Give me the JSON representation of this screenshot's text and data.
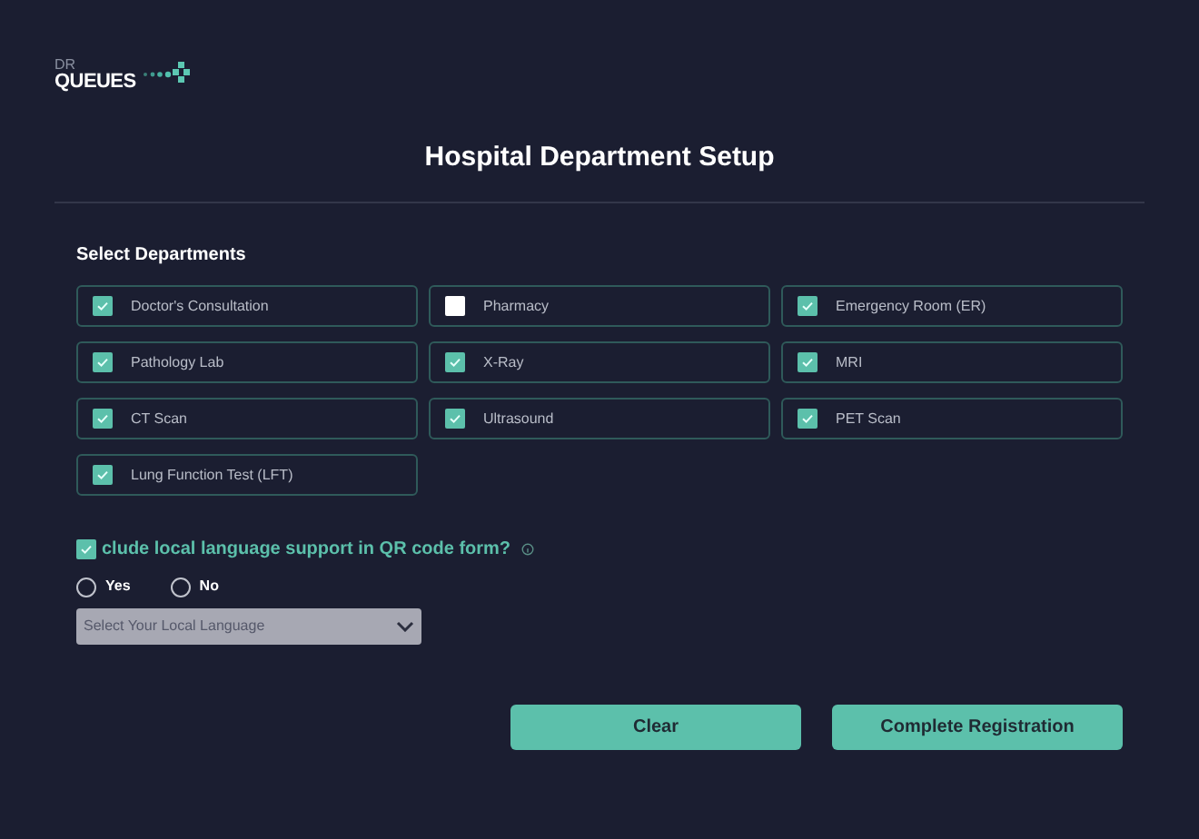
{
  "logo": {
    "line_1": "DR",
    "line_2": "QUEUES"
  },
  "title": "Hospital Department Setup",
  "section_label": "Select Departments",
  "departments": [
    {
      "label": "Doctor's Consultation",
      "checked": true
    },
    {
      "label": "Pharmacy",
      "checked": false
    },
    {
      "label": "Emergency Room (ER)",
      "checked": true
    },
    {
      "label": "Pathology Lab",
      "checked": true
    },
    {
      "label": "X-Ray",
      "checked": true
    },
    {
      "label": "MRI",
      "checked": true
    },
    {
      "label": "CT Scan",
      "checked": true
    },
    {
      "label": "Ultrasound",
      "checked": true
    },
    {
      "label": "PET Scan",
      "checked": true
    },
    {
      "label": "Lung Function Test (LFT)",
      "checked": true
    }
  ],
  "language_question": {
    "label": "clude local language support in QR code form?",
    "checked": true
  },
  "language_options": [
    {
      "label": "Yes",
      "selected": false
    },
    {
      "label": "No",
      "selected": false
    }
  ],
  "language_select": {
    "placeholder": "Select Your Local Language",
    "disabled": true
  },
  "buttons": [
    "Clear",
    "Complete Registration"
  ]
}
